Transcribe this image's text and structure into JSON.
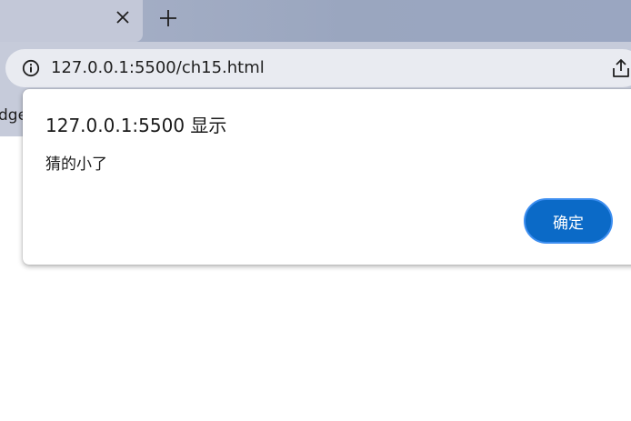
{
  "browser": {
    "tab": {
      "close_icon": "close-icon",
      "new_tab_icon": "plus-icon"
    },
    "address_bar": {
      "url": "127.0.0.1:5500/ch15.html",
      "site_info_icon": "info-icon",
      "share_icon": "share-icon"
    },
    "bookmarks_bar": {
      "partial_label": "dge"
    }
  },
  "dialog": {
    "title": "127.0.0.1:5500 显示",
    "message": "猜的小了",
    "ok_label": "确定"
  },
  "colors": {
    "accent": "#0b6ac7",
    "accent_border": "#3d8ef0",
    "chrome": "#c6cbda",
    "omnibox": "#e9ebf1"
  }
}
